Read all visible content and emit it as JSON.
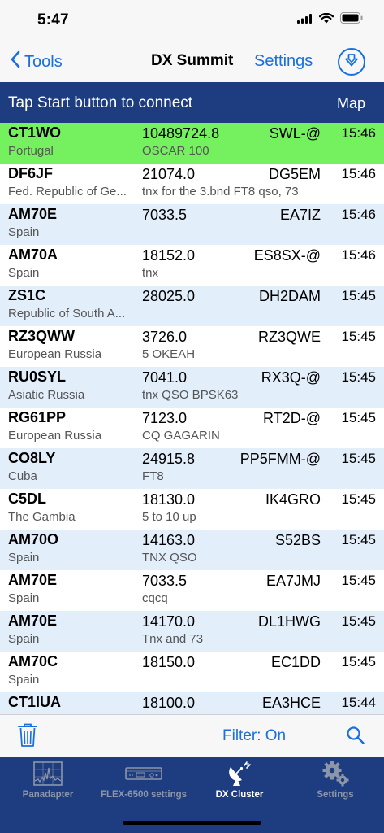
{
  "status": {
    "time": "5:47"
  },
  "nav": {
    "back_label": "Tools",
    "title": "DX Summit",
    "settings_label": "Settings"
  },
  "connection": {
    "message": "Tap Start button to connect",
    "map_label": "Map"
  },
  "spots": [
    {
      "call": "CT1WO",
      "country": "Portugal",
      "freq": "10489724.8",
      "comment": "OSCAR 100",
      "spotter": "SWL-@",
      "time": "15:46",
      "highlight": true
    },
    {
      "call": "DF6JF",
      "country": "Fed. Republic of Ge...",
      "freq": "21074.0",
      "comment": "tnx for the 3.bnd FT8 qso, 73",
      "spotter": "DG5EM",
      "time": "15:46"
    },
    {
      "call": "AM70E",
      "country": "Spain",
      "freq": "7033.5",
      "comment": "",
      "spotter": "EA7IZ",
      "time": "15:46"
    },
    {
      "call": "AM70A",
      "country": "Spain",
      "freq": "18152.0",
      "comment": "tnx",
      "spotter": "ES8SX-@",
      "time": "15:46"
    },
    {
      "call": "ZS1C",
      "country": "Republic of South A...",
      "freq": "28025.0",
      "comment": "",
      "spotter": "DH2DAM",
      "time": "15:45"
    },
    {
      "call": "RZ3QWW",
      "country": "European Russia",
      "freq": "3726.0",
      "comment": "5 OKEAH",
      "spotter": "RZ3QWE",
      "time": "15:45"
    },
    {
      "call": "RU0SYL",
      "country": "Asiatic Russia",
      "freq": "7041.0",
      "comment": "tnx QSO BPSK63",
      "spotter": "RX3Q-@",
      "time": "15:45"
    },
    {
      "call": "RG61PP",
      "country": "European Russia",
      "freq": "7123.0",
      "comment": "CQ GAGARIN",
      "spotter": "RT2D-@",
      "time": "15:45"
    },
    {
      "call": "CO8LY",
      "country": "Cuba",
      "freq": "24915.8",
      "comment": "FT8",
      "spotter": "PP5FMM-@",
      "time": "15:45"
    },
    {
      "call": "C5DL",
      "country": "The Gambia",
      "freq": "18130.0",
      "comment": "5 to 10 up",
      "spotter": "IK4GRO",
      "time": "15:45"
    },
    {
      "call": "AM70O",
      "country": "Spain",
      "freq": "14163.0",
      "comment": "TNX QSO",
      "spotter": "S52BS",
      "time": "15:45"
    },
    {
      "call": "AM70E",
      "country": "Spain",
      "freq": "7033.5",
      "comment": "cqcq",
      "spotter": "EA7JMJ",
      "time": "15:45"
    },
    {
      "call": "AM70E",
      "country": "Spain",
      "freq": "14170.0",
      "comment": "Tnx and 73",
      "spotter": "DL1HWG",
      "time": "15:45"
    },
    {
      "call": "AM70C",
      "country": "Spain",
      "freq": "18150.0",
      "comment": "",
      "spotter": "EC1DD",
      "time": "15:45"
    },
    {
      "call": "CT1IUA",
      "country": "",
      "freq": "18100.0",
      "comment": "",
      "spotter": "EA3HCE",
      "time": "15:44"
    }
  ],
  "toolbar": {
    "filter_label": "Filter: On"
  },
  "tabs": [
    {
      "label": "Panadapter",
      "icon": "panadapter-icon",
      "active": false
    },
    {
      "label": "FLEX-6500 settings",
      "icon": "radio-icon",
      "active": false
    },
    {
      "label": "DX Cluster",
      "icon": "satellite-dish-icon",
      "active": true
    },
    {
      "label": "Settings",
      "icon": "gears-icon",
      "active": false
    }
  ],
  "colors": {
    "accent": "#1a6fe0",
    "bar": "#1d3d80",
    "highlight": "#75f160",
    "row_alt": "#e3eefb"
  }
}
